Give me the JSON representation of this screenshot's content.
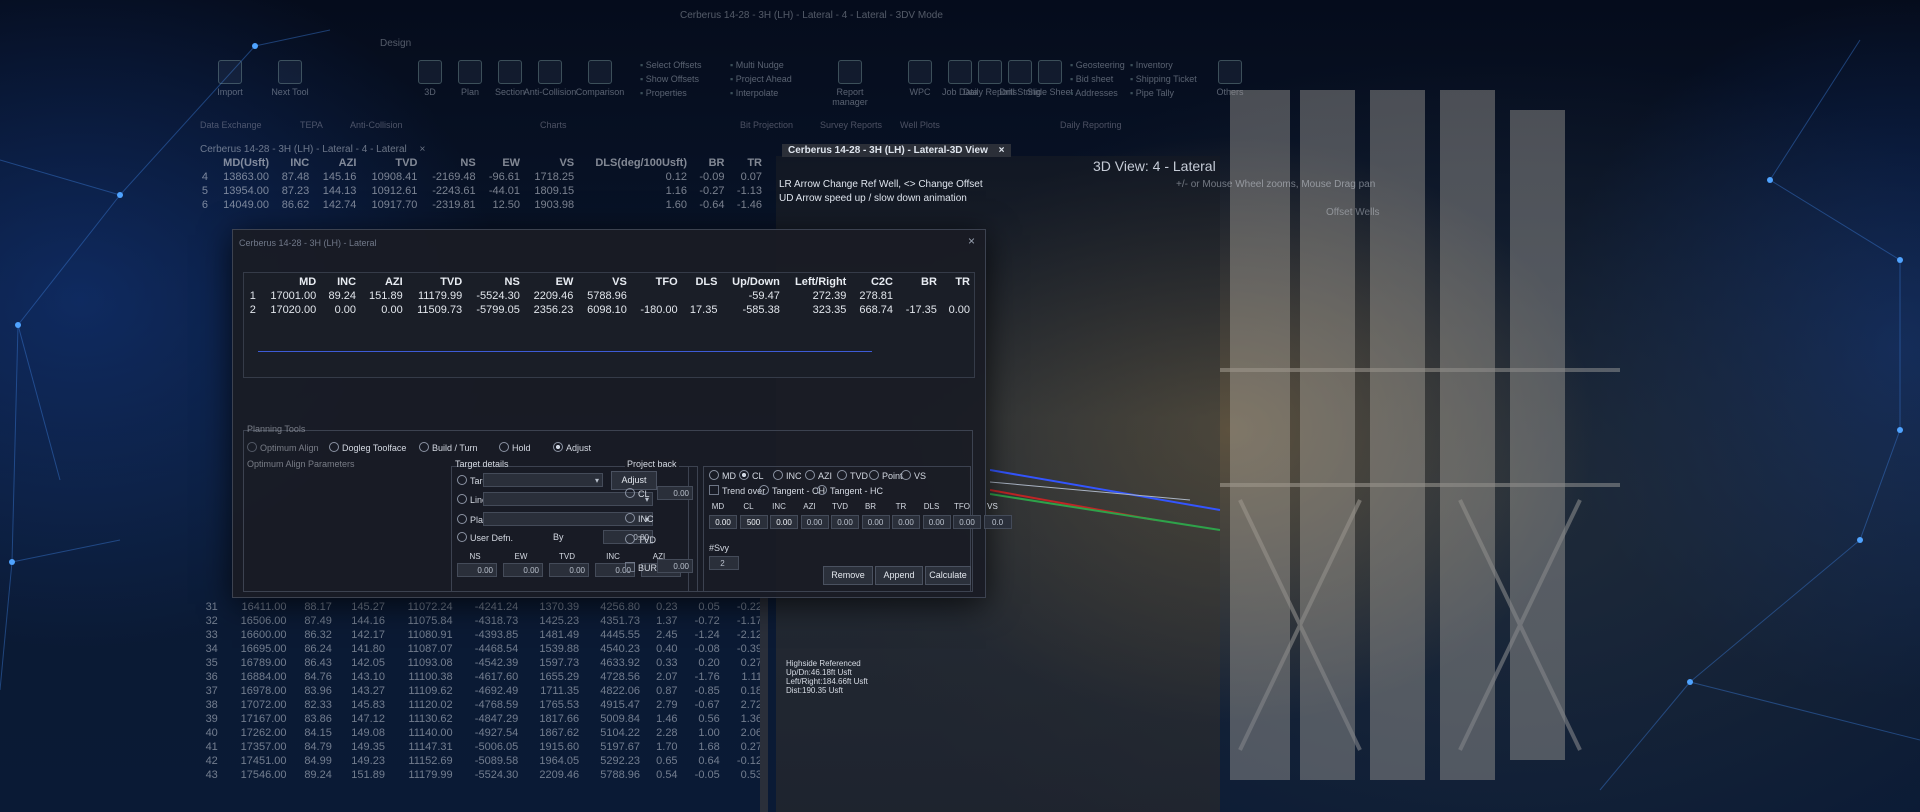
{
  "window_title": "Cerberus 14-28 - 3H (LH) - Lateral - 4 - Lateral - 3DV Mode",
  "ribbon": {
    "menu_tab": "Design",
    "buttons": [
      {
        "label": "Import"
      },
      {
        "label": "Next Tool"
      },
      {
        "label": "3D"
      },
      {
        "label": "Plan"
      },
      {
        "label": "Section"
      },
      {
        "label": "Anti-Collision"
      },
      {
        "label": "Comparison"
      },
      {
        "label": "Report manager"
      },
      {
        "label": "WPC"
      },
      {
        "label": "Job Data"
      },
      {
        "label": "Daily Reports"
      },
      {
        "label": "Drill String"
      },
      {
        "label": "Slide Sheet"
      },
      {
        "label": "Others"
      }
    ],
    "small_items": [
      {
        "label": "Select Offsets"
      },
      {
        "label": "Show Offsets"
      },
      {
        "label": "Properties"
      },
      {
        "label": "Multi Nudge"
      },
      {
        "label": "Project Ahead"
      },
      {
        "label": "Interpolate"
      },
      {
        "label": "Geosteering"
      },
      {
        "label": "Bid sheet"
      },
      {
        "label": "Addresses"
      },
      {
        "label": "Inventory"
      },
      {
        "label": "Shipping Ticket"
      },
      {
        "label": "Pipe Tally"
      }
    ],
    "groups": [
      {
        "label": "Data Exchange"
      },
      {
        "label": "TEPA"
      },
      {
        "label": "Anti-Collision"
      },
      {
        "label": "Charts"
      },
      {
        "label": "Bit Projection"
      },
      {
        "label": "Survey Reports"
      },
      {
        "label": "Well Plots"
      },
      {
        "label": "Daily Reporting"
      }
    ]
  },
  "left_tab": "Cerberus 14-28 - 3H (LH) - Lateral - 4 - Lateral",
  "right_tab": "Cerberus 14-28 - 3H (LH) - Lateral-3D View",
  "close_glyph": "×",
  "survey_top": {
    "headers": [
      "",
      "MD(Usft)",
      "INC",
      "AZI",
      "TVD",
      "NS",
      "EW",
      "VS",
      "DLS(deg/100Usft)",
      "BR",
      "TR"
    ],
    "rows": [
      [
        "4",
        "13863.00",
        "87.48",
        "145.16",
        "10908.41",
        "-2169.48",
        "-96.61",
        "1718.25",
        "0.12",
        "-0.09",
        "0.07"
      ],
      [
        "5",
        "13954.00",
        "87.23",
        "144.13",
        "10912.61",
        "-2243.61",
        "-44.01",
        "1809.15",
        "1.16",
        "-0.27",
        "-1.13"
      ],
      [
        "6",
        "14049.00",
        "86.62",
        "142.74",
        "10917.70",
        "-2319.81",
        "12.50",
        "1903.98",
        "1.60",
        "-0.64",
        "-1.46"
      ]
    ]
  },
  "view3d": {
    "title": "3D View: 4 - Lateral",
    "hint1": "LR Arrow Change Ref Well, <> Change Offset",
    "hint2": "UD Arrow speed up / slow down animation",
    "hint3": "+/- or Mouse Wheel zooms, Mouse Drag pan",
    "hint4": "Offset Wells",
    "overlay": [
      "Highside Referenced",
      "Up/Dn:46.18ft Usft",
      "Left/Right:184.66ft Usft",
      "Dist:190.35 Usft"
    ]
  },
  "dialog": {
    "title": "Cerberus 14-28 - 3H (LH) - Lateral",
    "close": "×",
    "grid_headers": [
      "",
      "MD",
      "INC",
      "AZI",
      "TVD",
      "NS",
      "EW",
      "VS",
      "TFO",
      "DLS",
      "Up/Down",
      "Left/Right",
      "C2C",
      "BR",
      "TR"
    ],
    "grid_rows": [
      [
        "1",
        "17001.00",
        "89.24",
        "151.89",
        "11179.99",
        "-5524.30",
        "2209.46",
        "5788.96",
        "",
        "",
        "-59.47",
        "272.39",
        "278.81",
        "",
        ""
      ],
      [
        "2",
        "17020.00",
        "0.00",
        "0.00",
        "11509.73",
        "-5799.05",
        "2356.23",
        "6098.10",
        "-180.00",
        "17.35",
        "-585.38",
        "323.35",
        "668.74",
        "-17.35",
        "0.00"
      ]
    ],
    "planning_tools": "Planning Tools",
    "modes": [
      "Optimum Align",
      "Dogleg Toolface",
      "Build / Turn",
      "Hold",
      "Adjust"
    ],
    "optimum_params": "Optimum Align Parameters",
    "target_details": "Target details",
    "project_back": "Project back",
    "target_label": "Target",
    "lineup_label": "Line-up",
    "plan_label": "Plan",
    "user_defined": "User Defn.",
    "by_label": "By",
    "by_value": "0.00",
    "adjust_btn": "Adjust",
    "cl_label": "CL",
    "cl_value": "0.00",
    "inc_label": "INC",
    "tvd_label": "TVD",
    "bur_label": "BUR",
    "bur_value": "0.00",
    "tgt_headers": [
      "NS",
      "EW",
      "TVD",
      "INC",
      "AZI"
    ],
    "tgt_values": [
      "0.00",
      "0.00",
      "0.00",
      "0.00",
      "0.00"
    ],
    "right_radios": [
      "MD",
      "CL",
      "INC",
      "AZI",
      "TVD",
      "Point",
      "VS"
    ],
    "trend_over": "Trend over",
    "tangent_ch": "Tangent - CH",
    "tangent_hc": "Tangent - HC",
    "calc_headers": [
      "MD",
      "CL",
      "INC",
      "AZI",
      "TVD",
      "BR",
      "TR",
      "DLS",
      "TFO",
      "VS"
    ],
    "calc_values": [
      "0.00",
      "500",
      "0.00",
      "0.00",
      "0.00",
      "0.00",
      "0.00",
      "0.00",
      "0.00",
      "0.0"
    ],
    "nsvy_label": "#Svy",
    "nsvy_value": "2",
    "buttons": {
      "remove": "Remove",
      "append": "Append",
      "calculate": "Calculate"
    }
  },
  "survey_bottom": {
    "rows": [
      [
        "31",
        "16411.00",
        "88.17",
        "145.27",
        "11072.24",
        "-4241.24",
        "1370.39",
        "4256.80",
        "0.23",
        "0.05",
        "-0.22"
      ],
      [
        "32",
        "16506.00",
        "87.49",
        "144.16",
        "11075.84",
        "-4318.73",
        "1425.23",
        "4351.73",
        "1.37",
        "-0.72",
        "-1.17"
      ],
      [
        "33",
        "16600.00",
        "86.32",
        "142.17",
        "11080.91",
        "-4393.85",
        "1481.49",
        "4445.55",
        "2.45",
        "-1.24",
        "-2.12"
      ],
      [
        "34",
        "16695.00",
        "86.24",
        "141.80",
        "11087.07",
        "-4468.54",
        "1539.88",
        "4540.23",
        "0.40",
        "-0.08",
        "-0.39"
      ],
      [
        "35",
        "16789.00",
        "86.43",
        "142.05",
        "11093.08",
        "-4542.39",
        "1597.73",
        "4633.92",
        "0.33",
        "0.20",
        "0.27"
      ],
      [
        "36",
        "16884.00",
        "84.76",
        "143.10",
        "11100.38",
        "-4617.60",
        "1655.29",
        "4728.56",
        "2.07",
        "-1.76",
        "1.11"
      ],
      [
        "37",
        "16978.00",
        "83.96",
        "143.27",
        "11109.62",
        "-4692.49",
        "1711.35",
        "4822.06",
        "0.87",
        "-0.85",
        "0.18"
      ],
      [
        "38",
        "17072.00",
        "82.33",
        "145.83",
        "11120.02",
        "-4768.59",
        "1765.53",
        "4915.47",
        "2.79",
        "-0.67",
        "2.72"
      ],
      [
        "39",
        "17167.00",
        "83.86",
        "147.12",
        "11130.62",
        "-4847.29",
        "1817.66",
        "5009.84",
        "1.46",
        "0.56",
        "1.36"
      ],
      [
        "40",
        "17262.00",
        "84.15",
        "149.08",
        "11140.00",
        "-4927.54",
        "1867.62",
        "5104.22",
        "2.28",
        "1.00",
        "2.06"
      ],
      [
        "41",
        "17357.00",
        "84.79",
        "149.35",
        "11147.31",
        "-5006.05",
        "1915.60",
        "5197.67",
        "1.70",
        "1.68",
        "0.27"
      ],
      [
        "42",
        "17451.00",
        "84.99",
        "149.23",
        "11152.69",
        "-5089.58",
        "1964.05",
        "5292.23",
        "0.65",
        "0.64",
        "-0.12"
      ],
      [
        "43",
        "17546.00",
        "89.24",
        "151.89",
        "11179.99",
        "-5524.30",
        "2209.46",
        "5788.96",
        "0.54",
        "-0.05",
        "0.53"
      ]
    ]
  }
}
